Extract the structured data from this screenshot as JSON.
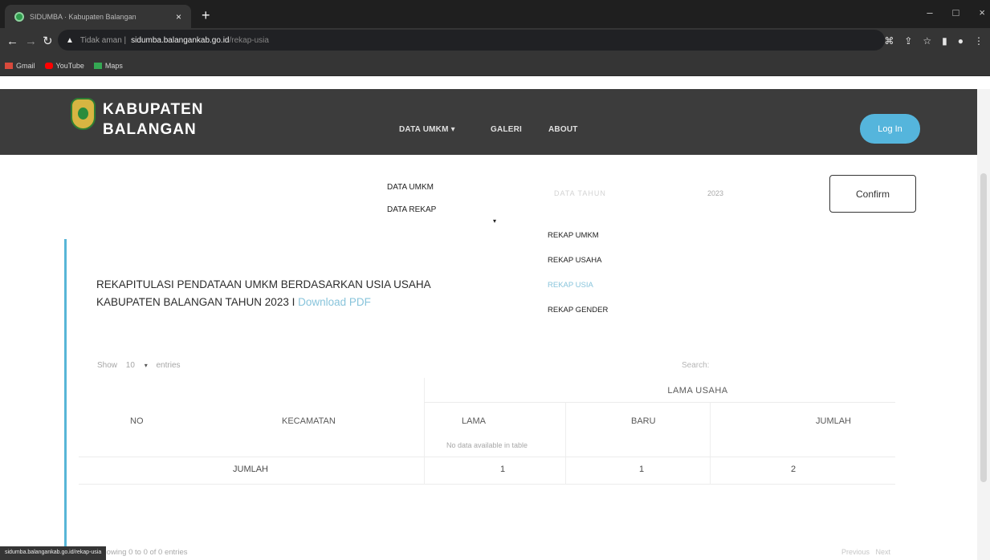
{
  "browser": {
    "tab_title": "SIDUMBA · Kabupaten Balangan",
    "tab_close": "×",
    "new_tab": "+",
    "window_controls": [
      "–",
      "□",
      "×"
    ],
    "security_text": "Tidak aman |",
    "url_host": "sidumba.balangankab.go.id",
    "url_path": "/rekap-usia",
    "toolbar_icons": [
      "translate-icon",
      "share-icon",
      "star-icon",
      "sidebar-icon",
      "profile-icon",
      "menu-icon"
    ],
    "bookmarks": [
      {
        "label": "Gmail",
        "icon": "gmail-icon",
        "color": "#d84a3c"
      },
      {
        "label": "YouTube",
        "icon": "youtube-icon",
        "color": "#ff0000"
      },
      {
        "label": "Maps",
        "icon": "maps-icon",
        "color": "#34a853"
      }
    ],
    "status_url": "sidumba.balangankab.go.id/rekap-usia"
  },
  "site": {
    "logo_line1": "KABUPATEN",
    "logo_line2": "BALANGAN",
    "nav": {
      "data_umkm": "DATA UMKM ▾",
      "galeri": "GALERI",
      "about": "ABOUT"
    },
    "login": "Log In"
  },
  "filters": {
    "data_umkm": "DATA UMKM",
    "data_rekap": "DATA REKAP",
    "rekap_arrow": "▾",
    "tahun_label": "DATA TAHUN",
    "tahun_value": "2023",
    "confirm": "Confirm"
  },
  "submenu": [
    "REKAP UMKM",
    "REKAP USAHA",
    "REKAP USIA",
    "REKAP GENDER"
  ],
  "title": {
    "line1": "REKAPITULASI PENDATAAN UMKM BERDASARKAN USIA USAHA",
    "line2_prefix": "KABUPATEN BALANGAN TAHUN 2023 I",
    "download": "Download PDF"
  },
  "table": {
    "show": "Show",
    "entries_value": "10",
    "entries": "entries",
    "search": "Search:",
    "group_header": "LAMA USAHA",
    "headers": {
      "no": "NO",
      "kecamatan": "KECAMATAN",
      "lama": "LAMA",
      "baru": "BARU",
      "jumlah": "JUMLAH"
    },
    "empty": "No data available in table",
    "total_row": {
      "label": "JUMLAH",
      "lama": "1",
      "baru": "1",
      "jumlah": "2"
    },
    "showing": "Showing 0 to 0 of 0 entries",
    "previous": "Previous",
    "next": "Next"
  }
}
